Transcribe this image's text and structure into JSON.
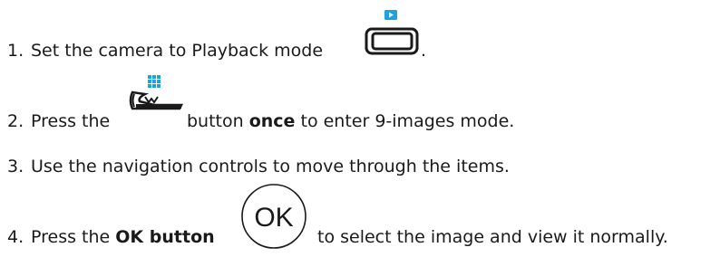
{
  "steps": [
    {
      "number": "1.",
      "before": "Set the camera to Playback mode",
      "after": "."
    },
    {
      "number": "2.",
      "before": "Press the",
      "after": "button",
      "bold": "once",
      "rest": "to enter 9-images mode."
    },
    {
      "number": "3.",
      "text": "Use the navigation controls to move through the items."
    },
    {
      "number": "4.",
      "before": "Press the",
      "bold": "OK button",
      "after": "to select the image and view it normally."
    }
  ],
  "icons": {
    "playback": "playback-mode-button",
    "thumbnail": "nine-image-thumbnail-button",
    "ok": "ok-button",
    "ok_label": "OK"
  },
  "colors": {
    "icon_accent": "#1aa3e0",
    "text": "#1a1a1a"
  }
}
